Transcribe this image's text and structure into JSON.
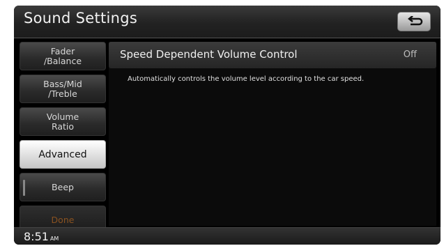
{
  "header": {
    "title": "Sound Settings",
    "back_icon": "back-arrow-icon"
  },
  "menu": {
    "items": [
      {
        "label": "Fader\n/Balance"
      },
      {
        "label": "Bass/Mid\n/Treble"
      },
      {
        "label": "Volume\nRatio"
      },
      {
        "label": "Advanced"
      },
      {
        "label": "Beep"
      },
      {
        "label": "Done"
      }
    ],
    "selected": "Advanced"
  },
  "content": {
    "setting_label": "Speed Dependent Volume Control",
    "setting_value": "Off",
    "description": "Automatically controls the volume level according to the car speed."
  },
  "status": {
    "time": "8:51",
    "ampm": "AM"
  },
  "colors": {
    "selected_bg": "#e8e8e8",
    "done_text": "#8a5220",
    "screen_bg": "#000000"
  }
}
